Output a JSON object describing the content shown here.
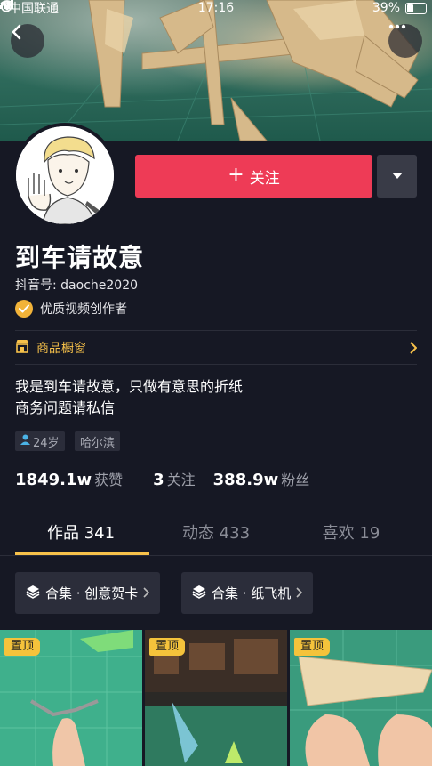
{
  "status_bar": {
    "carrier": "中国联通",
    "time": "17:16",
    "battery": "39%"
  },
  "profile": {
    "name": "到车请故意",
    "douyin_id": "抖音号: daoche2020",
    "verified_label": "优质视频创作者",
    "shop_label": "商品橱窗",
    "bio_line1": "我是到车请故意，只做有意思的折纸",
    "bio_line2": "商务问题请私信",
    "tags": [
      "24岁",
      "哈尔滨"
    ]
  },
  "actions": {
    "follow_label": "关注"
  },
  "stats": {
    "likes_value": "1849.1w",
    "likes_label": "获赞",
    "following_value": "3",
    "following_label": "关注",
    "fans_value": "388.9w",
    "fans_label": "粉丝"
  },
  "tabs": [
    {
      "label": "作品 341"
    },
    {
      "label": "动态 433"
    },
    {
      "label": "喜欢 19"
    }
  ],
  "collections": [
    {
      "label": "合集 · 创意贺卡"
    },
    {
      "label": "合集 · 纸飞机"
    }
  ],
  "videos": [
    {
      "pin_label": "置顶"
    },
    {
      "pin_label": "置顶"
    },
    {
      "pin_label": "置顶"
    }
  ],
  "colors": {
    "background": "#161824",
    "follow_button": "#ee3b56",
    "accent_yellow": "#f7c14a",
    "tag_bg": "#2b2d3a"
  },
  "icons": [
    "back-icon",
    "more-icon",
    "plus-icon",
    "caret-down-icon",
    "verified-check-icon",
    "shop-icon",
    "chevron-right-icon",
    "person-icon",
    "layers-icon",
    "wifi-icon",
    "alarm-icon",
    "lock-rotation-icon",
    "battery-icon"
  ]
}
